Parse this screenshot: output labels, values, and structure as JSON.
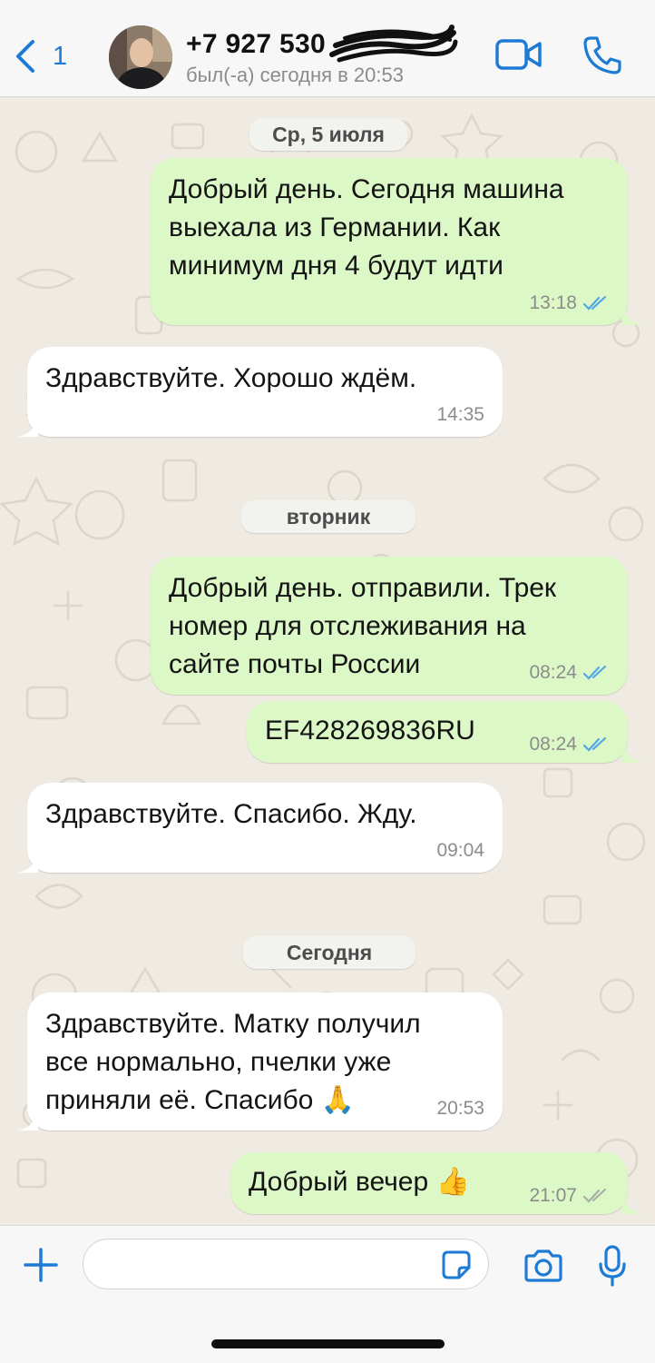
{
  "header": {
    "back_count": "1",
    "contact_name": "+7 927 530",
    "status": "был(-а) сегодня в 20:53",
    "icons": [
      "chevron-left-icon",
      "video-call-icon",
      "phone-icon"
    ]
  },
  "messages": [
    {
      "kind": "date",
      "text": "Ср, 5 июля"
    },
    {
      "kind": "out",
      "lines": [
        "Добрый день. Сегодня машина",
        "выехала из Германии. Как",
        "минимум дня 4 будут идти"
      ],
      "time": "13:18",
      "status": "read"
    },
    {
      "kind": "in",
      "lines": [
        "Здравствуйте. Хорошо ждём."
      ],
      "time": "14:35"
    },
    {
      "kind": "date",
      "text": "вторник"
    },
    {
      "kind": "out",
      "lines": [
        "Добрый день. отправили. Трек",
        "номер для отслеживания на",
        "сайте почты России"
      ],
      "time": "08:24",
      "status": "read"
    },
    {
      "kind": "out",
      "lines": [
        "EF428269836RU"
      ],
      "time": "08:24",
      "status": "read"
    },
    {
      "kind": "in",
      "lines": [
        "Здравствуйте. Спасибо. Жду."
      ],
      "time": "09:04"
    },
    {
      "kind": "date",
      "text": "Сегодня"
    },
    {
      "kind": "in",
      "lines": [
        "Здравствуйте. Матку получил",
        "все нормально, пчелки уже",
        "приняли её. Спасибо 🙏"
      ],
      "time": "20:53"
    },
    {
      "kind": "out",
      "lines": [
        "Добрый вечер 👍"
      ],
      "time": "21:07",
      "status": "delivered"
    }
  ],
  "composer": {
    "input_value": "",
    "icons": [
      "plus-icon",
      "sticker-icon",
      "camera-icon",
      "microphone-icon"
    ]
  },
  "colors": {
    "accent": "#1d7bd6",
    "outgoing_bubble": "#dcf8c6",
    "incoming_bubble": "#ffffff",
    "chat_background": "#efeae2",
    "read_ticks": "#53a6e8",
    "delivered_ticks": "#a8b0a6"
  }
}
